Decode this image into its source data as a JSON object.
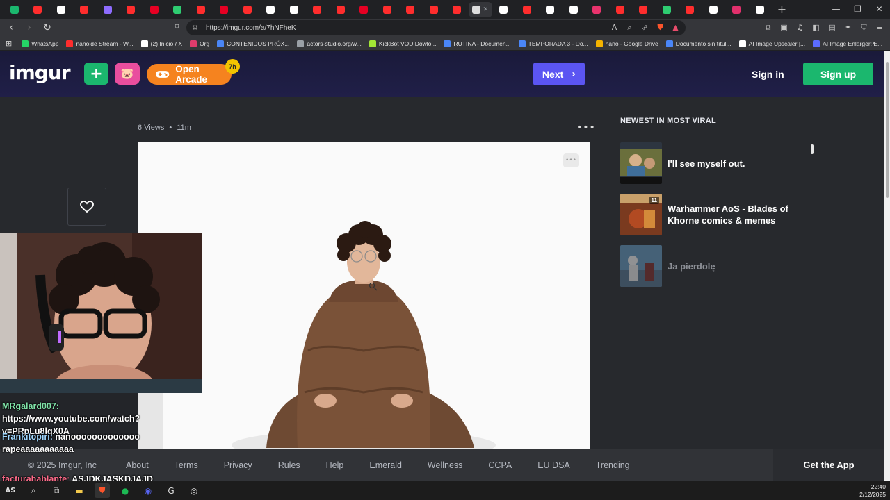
{
  "browser": {
    "tab_favicons": [
      "#1bb76e",
      "#ff2d2d",
      "#ffffff",
      "#ff2d2d",
      "#8e6cff",
      "#ff2d2d",
      "#e60023",
      "#2ecc71",
      "#ff2d2d",
      "#e60023",
      "#ff2d2d",
      "#ffffff",
      "#ffffff",
      "#ff2d2d",
      "#ff2d2d",
      "#e60023",
      "#ff2d2d",
      "#ff2d2d",
      "#ff2d2d",
      "#ff2d2d",
      "#dddddd",
      "#ffffff",
      "#ff2d2d",
      "#ffffff",
      "#ffffff",
      "#e8336d",
      "#ff2d2d",
      "#ff2d2d",
      "#2ecc71",
      "#ff2d2d",
      "#ffffff",
      "#e1306c",
      "#ffffff"
    ],
    "active_tab_index": 20,
    "url": "https://imgur.com/a/7hNFheK",
    "bookmarks": [
      {
        "label": "WhatsApp",
        "color": "#25d366"
      },
      {
        "label": "nanoide Stream - W...",
        "color": "#ff2d2d"
      },
      {
        "label": "(2) Inicio / X",
        "color": "#ffffff"
      },
      {
        "label": "Org",
        "color": "#e03c6c"
      },
      {
        "label": "CONTENIDOS PRÓX...",
        "color": "#4a86f7"
      },
      {
        "label": "actors-studio.org/w...",
        "color": "#9aa0a6"
      },
      {
        "label": "KickBot VOD Dowlo...",
        "color": "#a3e635"
      },
      {
        "label": "RUTINA - Documen...",
        "color": "#4a86f7"
      },
      {
        "label": "TEMPORADA 3 - Do...",
        "color": "#4a86f7"
      },
      {
        "label": "nano - Google Drive",
        "color": "#f4b400"
      },
      {
        "label": "Documento sin títul...",
        "color": "#4a86f7"
      },
      {
        "label": "AI Image Upscaler |...",
        "color": "#ffffff"
      },
      {
        "label": "AI Image Enlarger: E...",
        "color": "#5b6cff"
      }
    ]
  },
  "header": {
    "logo": "imgur",
    "upload_icon": "plus-icon",
    "arcade_label": "Open Arcade",
    "arcade_badge": "7h",
    "next_label": "Next",
    "signin_label": "Sign in",
    "signup_label": "Sign up"
  },
  "post": {
    "views": "6 Views",
    "age": "11m",
    "separator": "•"
  },
  "sidebar": {
    "title": "NEWEST IN MOST VIRAL",
    "items": [
      {
        "title": "I'll see myself out."
      },
      {
        "title": "Warhammer AoS - Blades of Khorne comics & memes",
        "badge": "11"
      },
      {
        "title": "Ja pierdolę"
      }
    ]
  },
  "chat": {
    "messages": [
      {
        "user": "MRgalard007:",
        "text": " https://www.youtube.com/watch?v=PRpLu8lqX0A"
      },
      {
        "user": "Frankitopiri:",
        "text": " nanooooooooooooo rapeaaaaaaaaaaa"
      },
      {
        "user": "facturahablante:",
        "text": " ASJDKJASKDJAJD"
      }
    ]
  },
  "footer": {
    "copyright": "© 2025 Imgur, Inc",
    "links": [
      "About",
      "Terms",
      "Privacy",
      "Rules",
      "Help",
      "Emerald",
      "Wellness",
      "CCPA",
      "EU DSA",
      "Trending"
    ],
    "get_app": "Get the App"
  },
  "taskbar": {
    "time": "22:40",
    "date": "2/12/2025"
  }
}
